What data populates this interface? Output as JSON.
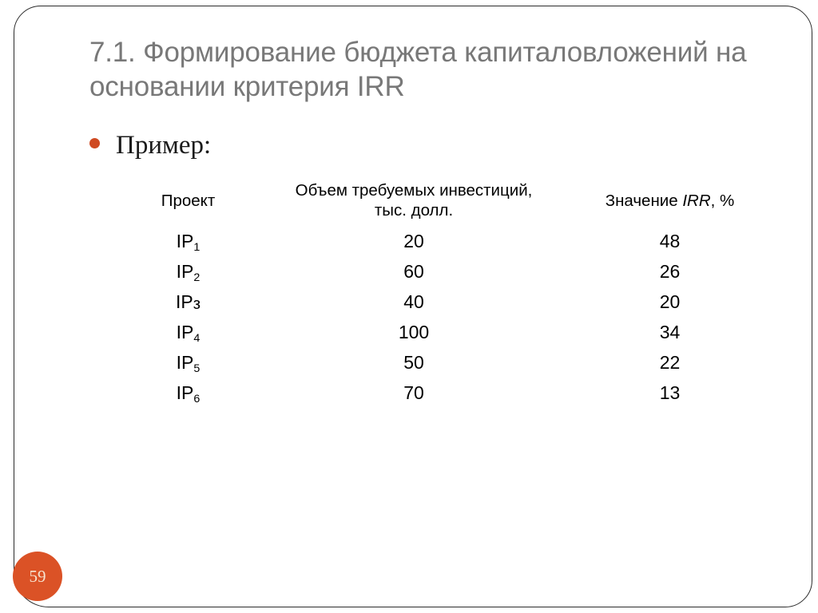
{
  "slide": {
    "title": "7.1. Формирование бюджета капиталовложений на основании критерия IRR",
    "title_color": "#787878",
    "page_number": "59",
    "badge_color": "#db5226",
    "bullet_color": "#cf4a22",
    "border_color": "#2b2b2b"
  },
  "bullet": {
    "marker": "bullet-dot-icon",
    "text": "Пример:"
  },
  "table": {
    "headers": {
      "project": "Проект",
      "investment_line1": "Объем требуемых инвестиций,",
      "investment_line2": "тыс. долл.",
      "irr_prefix": "Значение ",
      "irr_italic": "IRR",
      "irr_suffix": ", %"
    },
    "rows": [
      {
        "project_base": "IP",
        "project_index": "1",
        "project_label": "IP1",
        "investment": "20",
        "irr": "48"
      },
      {
        "project_base": "IP",
        "project_index": "2",
        "project_label": "IP2",
        "investment": "60",
        "irr": "26"
      },
      {
        "project_base": "IP",
        "project_index": "з",
        "project_label": "IPз",
        "investment": "40",
        "irr": "20"
      },
      {
        "project_base": "IP",
        "project_index": "4",
        "project_label": "IP4",
        "investment": "100",
        "irr": "34"
      },
      {
        "project_base": "IP",
        "project_index": "5",
        "project_label": "IP5",
        "investment": "50",
        "irr": "22"
      },
      {
        "project_base": "IP",
        "project_index": "6",
        "project_label": "IP6",
        "investment": "70",
        "irr": "13"
      }
    ]
  }
}
